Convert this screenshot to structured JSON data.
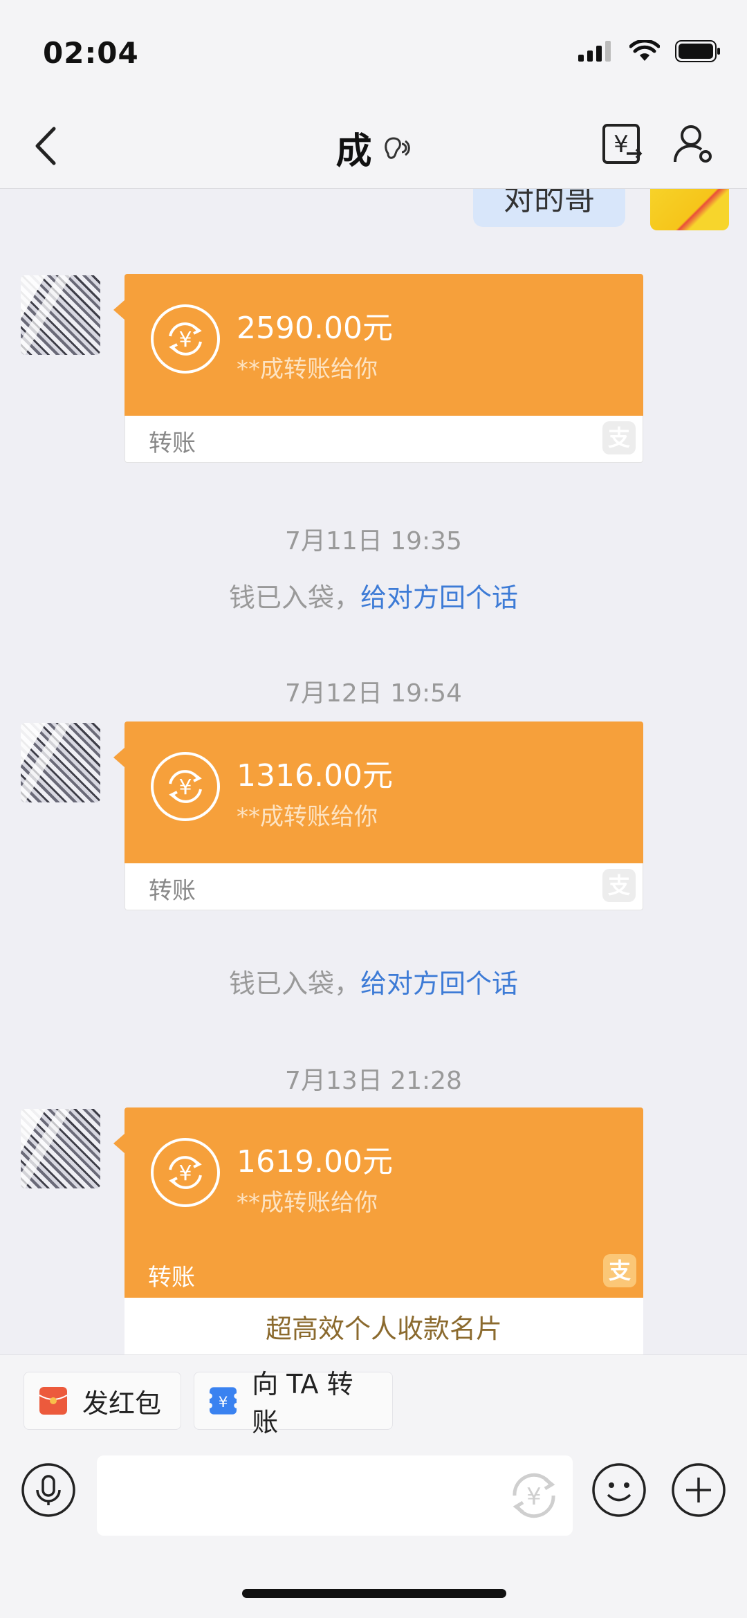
{
  "status_bar": {
    "time": "02:04"
  },
  "nav": {
    "title": "成"
  },
  "chat": {
    "my_message": "对的哥",
    "transfers": [
      {
        "amount": "2590.00元",
        "subtitle": "**成转账给你",
        "label": "转账"
      },
      {
        "amount": "1316.00元",
        "subtitle": "**成转账给你",
        "label": "转账"
      },
      {
        "amount": "1619.00元",
        "subtitle": "**成转账给你",
        "label": "转账",
        "card_text": "超高效个人收款名片"
      }
    ],
    "timestamps": [
      "7月11日 19:35",
      "7月12日 19:54",
      "7月13日 21:28"
    ],
    "system_messages": [
      {
        "text": "钱已入袋，",
        "link": "给对方回个话"
      },
      {
        "text": "钱已入袋，",
        "link": "给对方回个话"
      }
    ],
    "alipay_glyph": "支"
  },
  "quick_actions": {
    "red_packet": "发红包",
    "transfer_to": "向 TA 转账"
  },
  "colors": {
    "transfer_orange": "#f6a03b",
    "link_blue": "#3d7bd6",
    "red_packet": "#ec5a3c",
    "transfer_blue": "#3a82f0"
  }
}
